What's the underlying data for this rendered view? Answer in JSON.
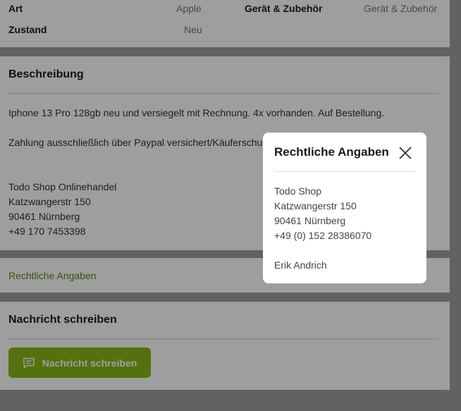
{
  "attributes": [
    {
      "label": "Art",
      "value": "Apple"
    },
    {
      "label": "Gerät & Zubehör",
      "value": "Gerät & Zubehör"
    },
    {
      "label": "Zustand",
      "value": "Neu"
    }
  ],
  "description": {
    "title": "Beschreibung",
    "lines": [
      "Iphone 13 Pro 128gb neu und versiegelt mit Rechnung. 4x vorhanden. Auf Bestellung.",
      "Zahlung ausschließlich über Paypal versichert/Käuferschu",
      "Todo Shop Onlinehandel",
      "Katzwangerstr 150",
      "90461 Nürnberg",
      "+49 170 7453398"
    ]
  },
  "legal": {
    "link_label": "Rechtliche Angaben"
  },
  "message": {
    "title": "Nachricht schreiben",
    "button_label": "Nachricht schreiben"
  },
  "modal": {
    "title": "Rechtliche Angaben",
    "lines": [
      "Todo Shop",
      "Katzwangerstr 150",
      "90461 Nürnberg",
      "+49 (0) 152 28386070",
      "Erik Andrich"
    ]
  },
  "colors": {
    "accent": "#86b817",
    "link": "#5b8a1b",
    "overlay": "rgba(0,0,0,0.38)"
  },
  "icons": {
    "message_button": "chat-bubble-icon",
    "modal_close": "close-icon"
  }
}
